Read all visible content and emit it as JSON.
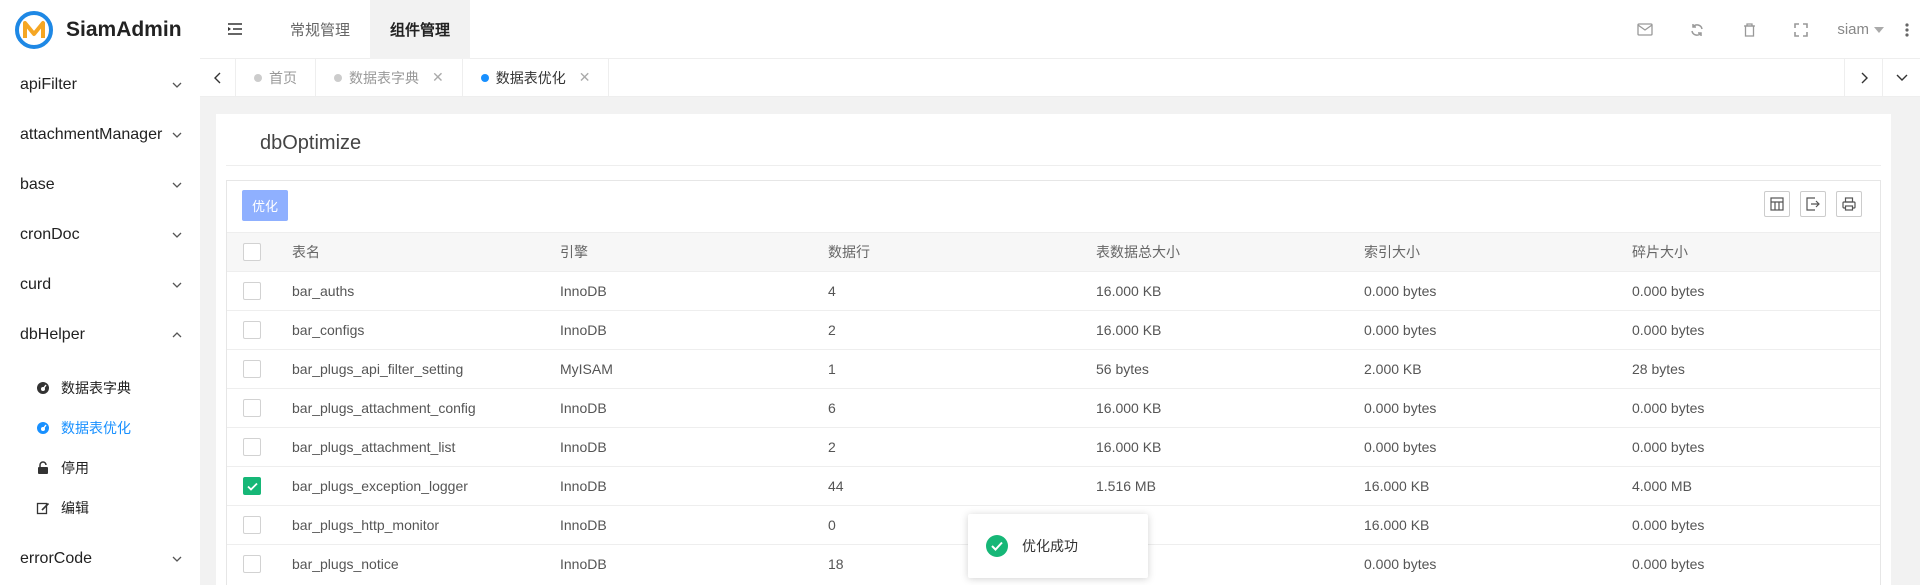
{
  "app": {
    "name": "SiamAdmin"
  },
  "header": {
    "tabs": [
      {
        "label": "常规管理"
      },
      {
        "label": "组件管理"
      }
    ],
    "user": "siam"
  },
  "sidebar": {
    "groups": [
      {
        "label": "apiFilter"
      },
      {
        "label": "attachmentManager"
      },
      {
        "label": "base"
      },
      {
        "label": "cronDoc"
      },
      {
        "label": "curd"
      },
      {
        "label": "dbHelper"
      },
      {
        "label": "errorCode"
      }
    ],
    "dbhelper_items": [
      {
        "label": "数据表字典",
        "icon": "dashboard-icon"
      },
      {
        "label": "数据表优化",
        "icon": "dashboard-icon"
      },
      {
        "label": "停用",
        "icon": "unlock-icon"
      },
      {
        "label": "编辑",
        "icon": "edit-icon"
      }
    ]
  },
  "page_tabs": [
    {
      "label": "首页"
    },
    {
      "label": "数据表字典"
    },
    {
      "label": "数据表优化"
    }
  ],
  "card": {
    "title": "dbOptimize",
    "optimize_button": "优化"
  },
  "table": {
    "headers": [
      "表名",
      "引擎",
      "数据行",
      "表数据总大小",
      "索引大小",
      "碎片大小"
    ],
    "rows": [
      [
        "bar_auths",
        "InnoDB",
        "4",
        "16.000 KB",
        "0.000 bytes",
        "0.000 bytes"
      ],
      [
        "bar_configs",
        "InnoDB",
        "2",
        "16.000 KB",
        "0.000 bytes",
        "0.000 bytes"
      ],
      [
        "bar_plugs_api_filter_setting",
        "MyISAM",
        "1",
        "56 bytes",
        "2.000 KB",
        "28 bytes"
      ],
      [
        "bar_plugs_attachment_config",
        "InnoDB",
        "6",
        "16.000 KB",
        "0.000 bytes",
        "0.000 bytes"
      ],
      [
        "bar_plugs_attachment_list",
        "InnoDB",
        "2",
        "16.000 KB",
        "0.000 bytes",
        "0.000 bytes"
      ],
      [
        "bar_plugs_exception_logger",
        "InnoDB",
        "44",
        "1.516 MB",
        "16.000 KB",
        "4.000 MB"
      ],
      [
        "bar_plugs_http_monitor",
        "InnoDB",
        "0",
        "KB",
        "16.000 KB",
        "0.000 bytes"
      ],
      [
        "bar_plugs_notice",
        "InnoDB",
        "18",
        "KB",
        "0.000 bytes",
        "0.000 bytes"
      ]
    ],
    "checked": [
      false,
      false,
      false,
      false,
      false,
      true,
      false,
      false
    ]
  },
  "toast": {
    "message": "优化成功"
  },
  "colors": {
    "accent": "#1890ff",
    "success": "#16b777",
    "button": "#8fb0ff"
  }
}
